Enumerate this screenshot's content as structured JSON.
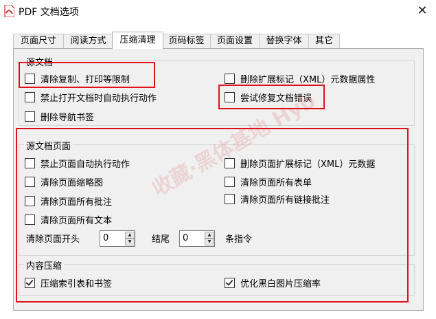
{
  "window": {
    "title": "PDF 文档选项"
  },
  "tabs": [
    "页面尺寸",
    "阅读方式",
    "压缩清理",
    "页码标签",
    "页面设置",
    "替换字体",
    "其它"
  ],
  "source_doc": {
    "legend": "源文档",
    "options": [
      {
        "label": "清除复制、打印等限制",
        "checked": false
      },
      {
        "label": "删除扩展标记（XML）元数据属性",
        "checked": false
      },
      {
        "label": "禁止打开文档时自动执行动作",
        "checked": false
      },
      {
        "label": "尝试修复文档错误",
        "checked": false
      },
      {
        "label": "删除导航书签",
        "checked": false
      }
    ]
  },
  "source_pages": {
    "legend": "源文档页面",
    "options": [
      {
        "label": "禁止页面自动执行动作",
        "checked": false
      },
      {
        "label": "删除页面扩展标记（XML）元数据",
        "checked": false
      },
      {
        "label": "清除页面缩略图",
        "checked": false
      },
      {
        "label": "清除页面所有表单",
        "checked": false
      },
      {
        "label": "清除页面所有批注",
        "checked": false
      },
      {
        "label": "清除页面所有链接批注",
        "checked": false
      },
      {
        "label": "清除页面所有文本",
        "checked": false
      }
    ],
    "clear_start_label": "清除页面开头",
    "start_value": "0",
    "end_label": "结尾",
    "end_value": "0",
    "instructions_label": "条指令"
  },
  "compression": {
    "legend": "内容压缩",
    "options": [
      {
        "label": "压缩索引表和书签",
        "checked": true
      },
      {
        "label": "优化黑白图片压缩率",
        "checked": true
      }
    ]
  },
  "watermark_text": "收藏·黑体基地 Hyb",
  "colors": {
    "highlight": "#e0101a",
    "panel": "#f0f0f0",
    "app_icon": "#d9261c"
  }
}
